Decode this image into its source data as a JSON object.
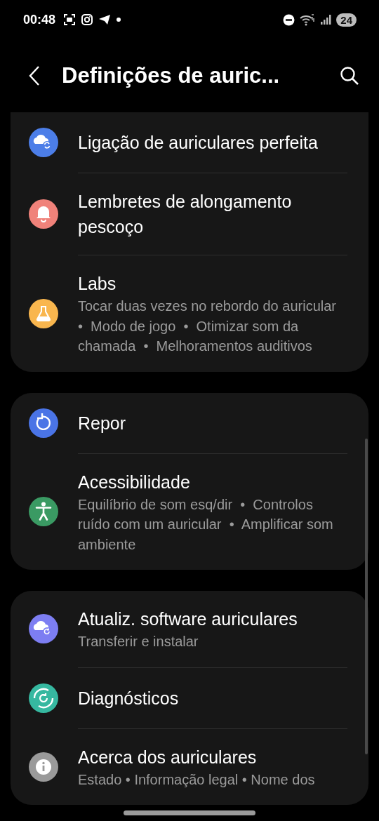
{
  "status_bar": {
    "time": "00:48",
    "battery": "24"
  },
  "header": {
    "title": "Definições de auric..."
  },
  "groups": [
    {
      "items": [
        {
          "title": "Ligação de auriculares perfeita",
          "kind": "cloud-sync",
          "color": "#4c7ee8"
        },
        {
          "title": "Lembretes de alongamento pescoço",
          "kind": "bell",
          "color": "#f0827a"
        },
        {
          "title": "Labs",
          "subtitle": "Tocar duas vezes no rebordo do auricular  •  Modo de jogo  •  Otimizar som da chamada  •  Melhoramentos auditivos",
          "kind": "flask",
          "color": "#f9b64e"
        }
      ]
    },
    {
      "items": [
        {
          "title": "Repor",
          "kind": "reset",
          "color": "#4a74e6"
        },
        {
          "title": "Acessibilidade",
          "subtitle": "Equilíbrio de som esq/dir  •  Controlos ruído com um auricular  •  Amplificar som ambiente",
          "kind": "person",
          "color": "#3a9a63"
        }
      ]
    },
    {
      "items": [
        {
          "title": "Atualiz. software auriculares",
          "subtitle": "Transferir e instalar",
          "kind": "cloud-update",
          "color": "#7d7ef2"
        },
        {
          "title": "Diagnósticos",
          "kind": "diagnostics",
          "color": "#36b8a0"
        },
        {
          "title": "Acerca dos auriculares",
          "subtitle": "Estado • Informação legal • Nome dos",
          "kind": "info",
          "color": "#9a9a9a"
        }
      ]
    }
  ]
}
